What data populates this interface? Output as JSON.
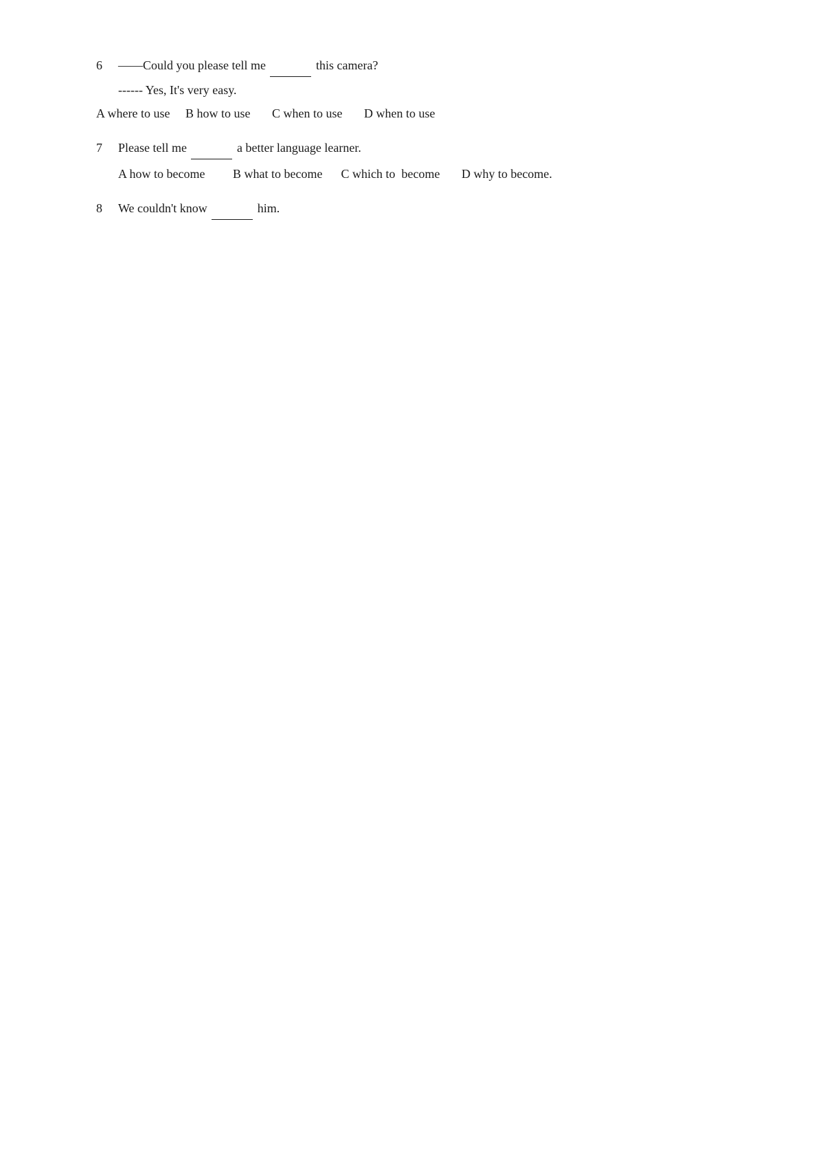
{
  "questions": [
    {
      "number": "6",
      "prefix": "——Could",
      "text_before_blank": " you please tell me ",
      "blank": true,
      "text_after_blank": " this camera?",
      "answer_line": "------ Yes, It's very easy.",
      "options": [
        {
          "letter": "A",
          "text": "where to use"
        },
        {
          "letter": "B",
          "text": "how to use"
        },
        {
          "letter": "C",
          "text": "when to use"
        },
        {
          "letter": "D",
          "text": "when to use"
        }
      ]
    },
    {
      "number": "7",
      "prefix": "",
      "text_before_blank": "Please tell me ",
      "blank": true,
      "text_after_blank": " a better language learner.",
      "answer_line": "",
      "options": [
        {
          "letter": "A",
          "text": "how to become"
        },
        {
          "letter": "B",
          "text": "what to become"
        },
        {
          "letter": "C",
          "text": "which to  become"
        },
        {
          "letter": "D",
          "text": "why to become."
        }
      ]
    },
    {
      "number": "8",
      "prefix": "",
      "text_before_blank": "We couldn't know ",
      "blank": true,
      "text_after_blank": " him.",
      "answer_line": "",
      "options": []
    }
  ]
}
